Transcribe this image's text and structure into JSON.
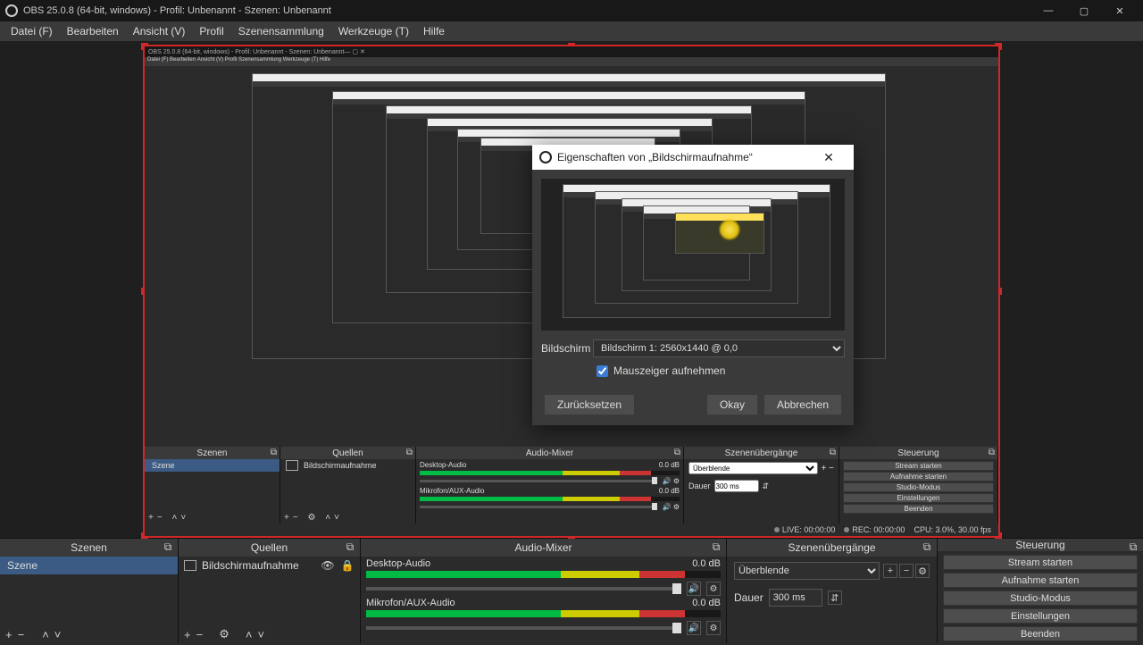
{
  "title": "OBS 25.0.8 (64-bit, windows) - Profil: Unbenannt - Szenen: Unbenannt",
  "menu": {
    "file": "Datei (F)",
    "edit": "Bearbeiten",
    "view": "Ansicht (V)",
    "profile": "Profil",
    "scenecol": "Szenensammlung",
    "tools": "Werkzeuge (T)",
    "help": "Hilfe"
  },
  "dialog": {
    "title": "Eigenschaften von „Bildschirmaufnahme“",
    "field_display": "Bildschirm",
    "display_value": "Bildschirm 1: 2560x1440 @ 0,0",
    "capture_cursor": "Mauszeiger aufnehmen",
    "reset": "Zurücksetzen",
    "ok": "Okay",
    "cancel": "Abbrechen"
  },
  "docks": {
    "scenes": {
      "title": "Szenen",
      "item": "Szene"
    },
    "sources": {
      "title": "Quellen",
      "item": "Bildschirmaufnahme"
    },
    "mixer": {
      "title": "Audio-Mixer",
      "ch1_name": "Desktop-Audio",
      "ch1_db": "0.0 dB",
      "ch2_name": "Mikrofon/AUX-Audio",
      "ch2_db": "0.0 dB"
    },
    "trans": {
      "title": "Szenenübergänge",
      "type": "Überblende",
      "dur_label": "Dauer",
      "dur_val": "300 ms"
    },
    "ctrl": {
      "title": "Steuerung",
      "stream": "Stream starten",
      "record": "Aufnahme starten",
      "studio": "Studio-Modus",
      "settings": "Einstellungen",
      "exit": "Beenden"
    }
  },
  "status": {
    "live": "LIVE: 00:00:00",
    "rec": "REC: 00:00:00",
    "cpu": "CPU: 3.0%, 30.00 fps"
  }
}
